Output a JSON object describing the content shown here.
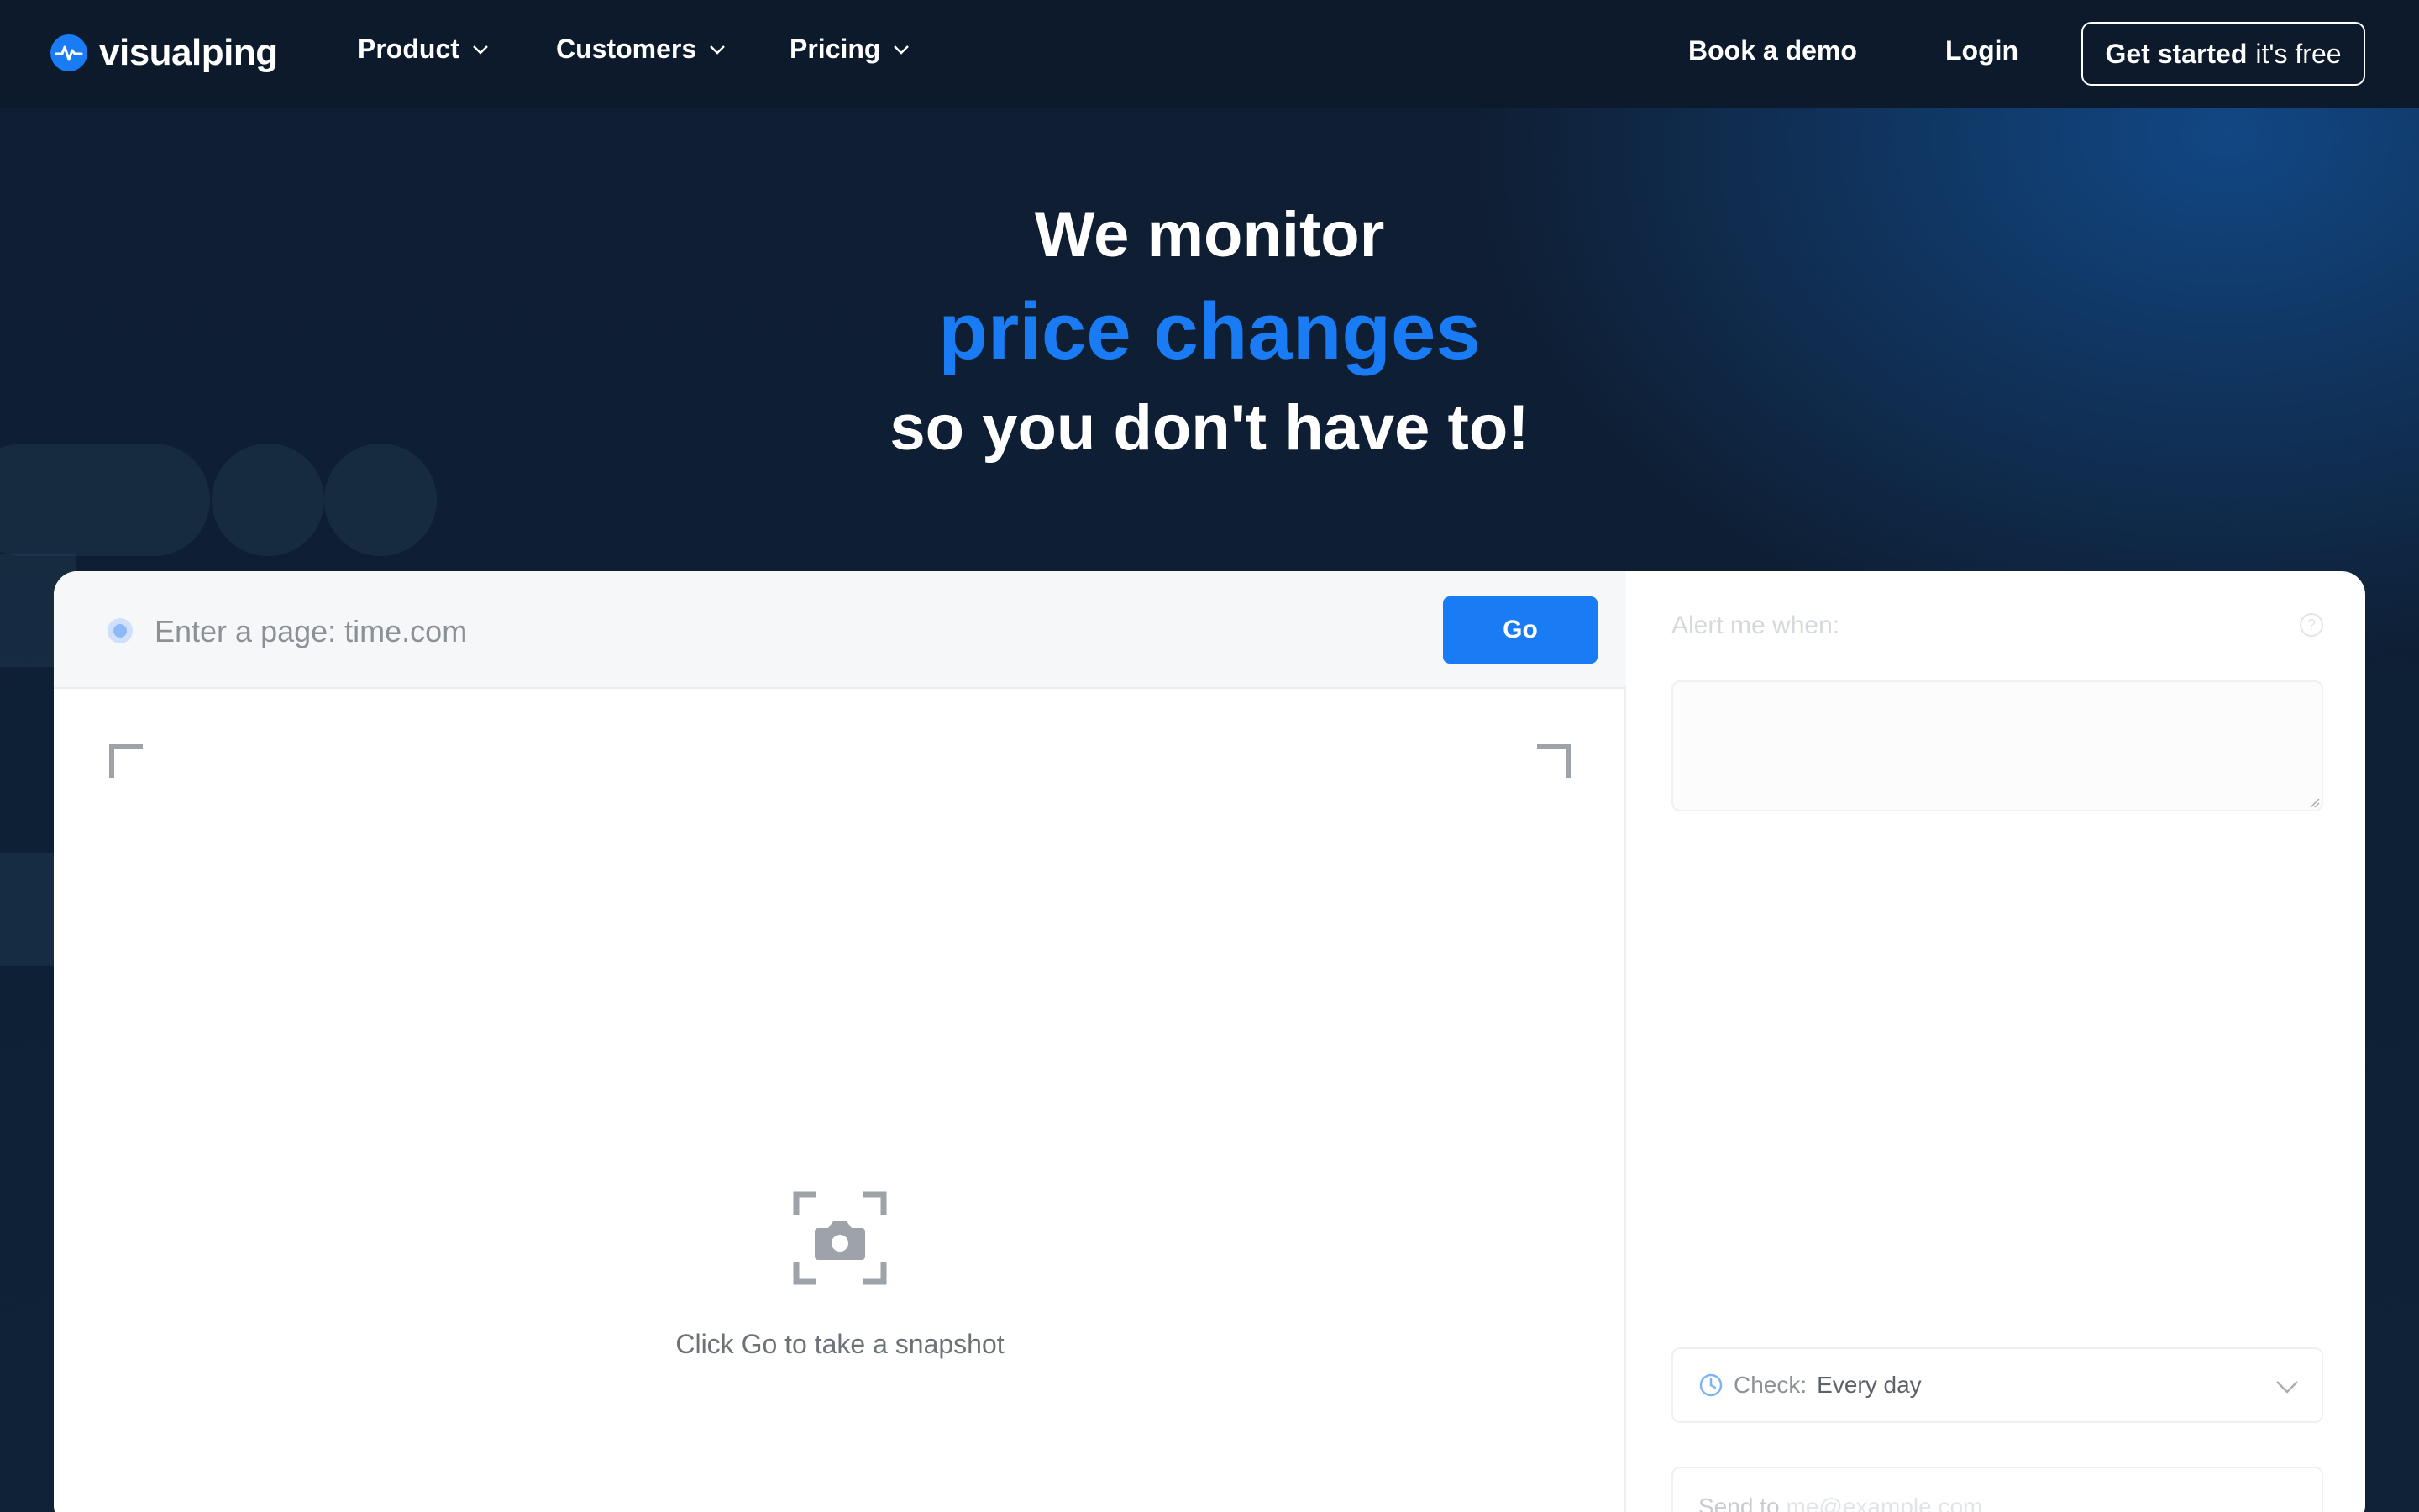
{
  "brand": {
    "name": "visualping",
    "accent": "#1a7cf5",
    "nav_bg": "#0c1a2c"
  },
  "nav": {
    "items": [
      {
        "label": "Product"
      },
      {
        "label": "Customers"
      },
      {
        "label": "Pricing"
      }
    ],
    "book_demo": "Book a demo",
    "login": "Login",
    "cta_bold": "Get started",
    "cta_light": "it's free"
  },
  "hero": {
    "line1": "We monitor",
    "line2": "price changes",
    "line3": "so you don't have to!"
  },
  "snapshot": {
    "url_placeholder": "Enter a page: time.com",
    "go_label": "Go",
    "empty_text": "Click Go to take a snapshot"
  },
  "alert": {
    "label": "Alert me when:",
    "check_label": "Check:",
    "check_value": "Every day",
    "send_label": "Send to",
    "send_placeholder": "me@example.com"
  }
}
